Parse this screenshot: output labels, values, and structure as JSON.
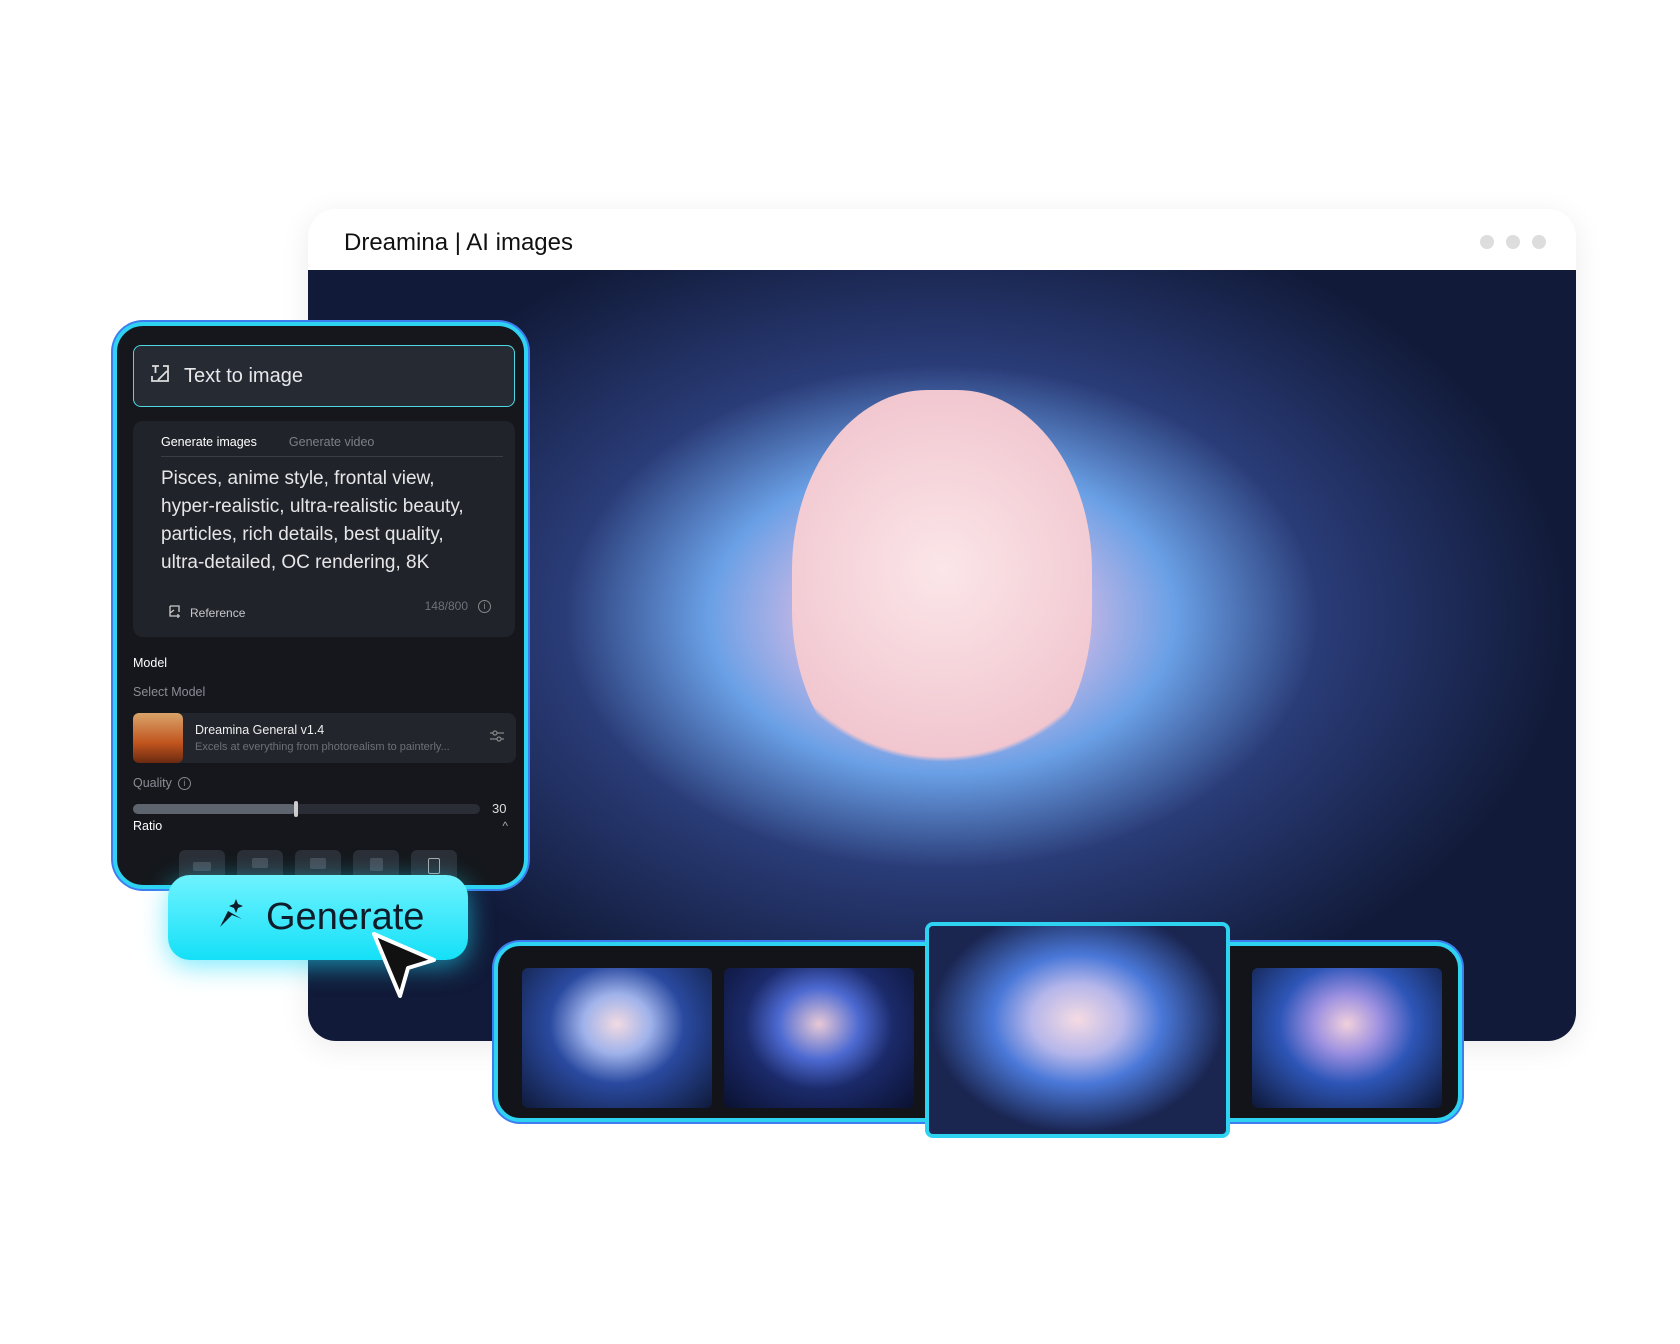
{
  "window": {
    "title": "Dreamina | AI images"
  },
  "panel": {
    "mode_label": "Text to image",
    "tabs": [
      {
        "label": "Generate images",
        "active": true
      },
      {
        "label": "Generate video",
        "active": false
      }
    ],
    "prompt": "Pisces, anime style, frontal view, hyper-realistic, ultra-realistic beauty, particles, rich details,  best quality, ultra-detailed, OC rendering, 8K",
    "reference_label": "Reference",
    "char_count": "148/800",
    "model_heading": "Model",
    "select_model_label": "Select Model",
    "model": {
      "name": "Dreamina General v1.4",
      "description": "Excels at everything from photorealism to painterly..."
    },
    "quality_label": "Quality",
    "quality_value": "30",
    "quality_fraction": 0.47,
    "ratio_label": "Ratio"
  },
  "generate_button": {
    "label": "Generate"
  },
  "colors": {
    "accent": "#2fd3f2",
    "panel_bg": "#15171c",
    "button": "#14e0f7"
  }
}
